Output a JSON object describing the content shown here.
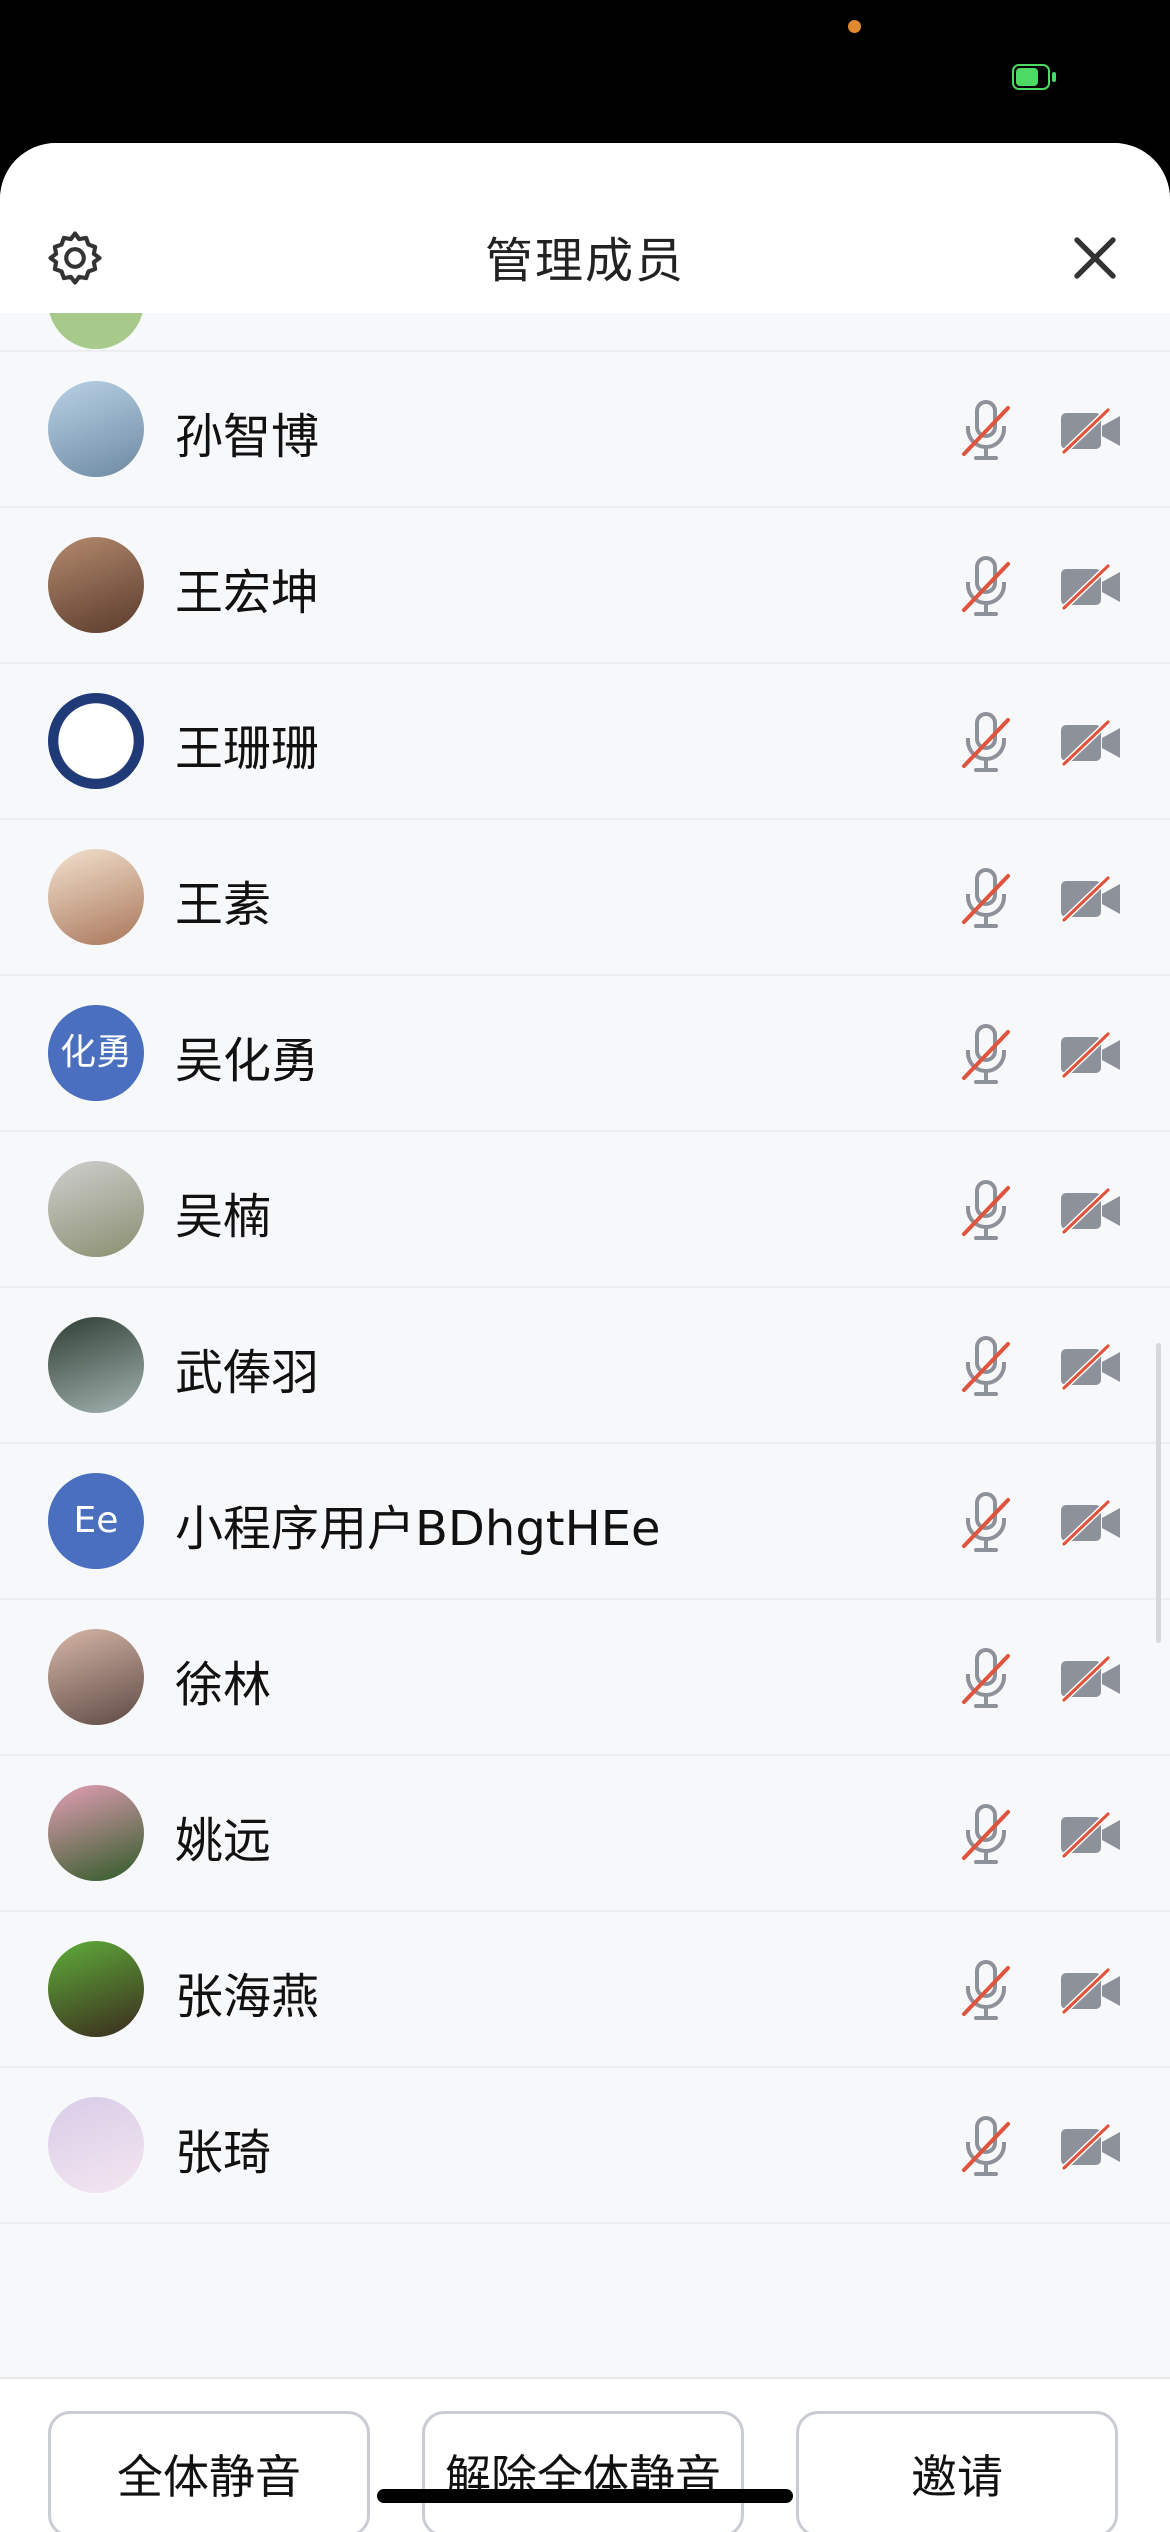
{
  "header": {
    "title": "管理成员"
  },
  "members": [
    {
      "name": "孙智博",
      "avatar_kind": "photo",
      "avatar_colors": [
        "#b9d1e6",
        "#6d8aa2"
      ]
    },
    {
      "name": "王宏坤",
      "avatar_kind": "photo",
      "avatar_colors": [
        "#b48a6e",
        "#5a3b2c"
      ]
    },
    {
      "name": "王珊珊",
      "avatar_kind": "logo",
      "avatar_colors": [
        "#ffffff",
        "#203a78"
      ]
    },
    {
      "name": "王素",
      "avatar_kind": "photo",
      "avatar_colors": [
        "#f3e2cf",
        "#a9765a"
      ]
    },
    {
      "name": "吴化勇",
      "avatar_kind": "text",
      "avatar_text": "化勇",
      "avatar_colors": [
        "#4a6fbf",
        "#4a6fbf"
      ]
    },
    {
      "name": "吴楠",
      "avatar_kind": "photo",
      "avatar_colors": [
        "#cfcfcf",
        "#8a8f70"
      ]
    },
    {
      "name": "武俸羽",
      "avatar_kind": "photo",
      "avatar_colors": [
        "#2f3e34",
        "#a3b3b0"
      ]
    },
    {
      "name": "小程序用户BDhgtHEe",
      "avatar_kind": "text",
      "avatar_text": "Ee",
      "avatar_colors": [
        "#4a6fbf",
        "#4a6fbf"
      ]
    },
    {
      "name": "徐林",
      "avatar_kind": "photo",
      "avatar_colors": [
        "#d7b7a8",
        "#5d4a44"
      ]
    },
    {
      "name": "姚远",
      "avatar_kind": "photo",
      "avatar_colors": [
        "#e59fb7",
        "#2e5a26"
      ]
    },
    {
      "name": "张海燕",
      "avatar_kind": "photo",
      "avatar_colors": [
        "#5fae3b",
        "#3b2a1d"
      ]
    },
    {
      "name": "张琦",
      "avatar_kind": "photo",
      "avatar_colors": [
        "#d8cce8",
        "#f4e6f0"
      ]
    }
  ],
  "footer": {
    "mute_all": "全体静音",
    "unmute_all": "解除全体静音",
    "invite": "邀请"
  },
  "colors": {
    "muted_slash": "#e0533d",
    "icon_gray": "#8d9199"
  }
}
